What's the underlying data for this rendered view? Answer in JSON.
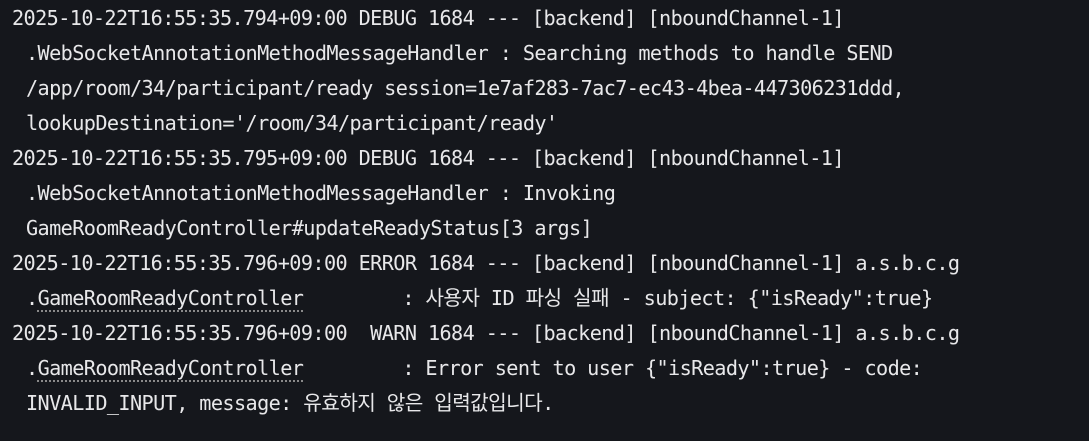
{
  "log": {
    "entries": [
      {
        "header": "2025-10-22T16:55:35.794+09:00 DEBUG 1684 --- [backend] [nboundChannel-1]",
        "logger": ".WebSocketAnnotationMethodMessageHandler",
        "message": " : Searching methods to handle SEND",
        "continuation": [
          "/app/room/34/participant/ready session=1e7af283-7ac7-ec43-4bea-447306231ddd,",
          "lookupDestination='/room/34/participant/ready'"
        ]
      },
      {
        "header": "2025-10-22T16:55:35.795+09:00 DEBUG 1684 --- [backend] [nboundChannel-1]",
        "logger": ".WebSocketAnnotationMethodMessageHandler",
        "message": " : Invoking",
        "continuation": [
          "GameRoomReadyController#updateReadyStatus[3 args]"
        ]
      },
      {
        "header": "2025-10-22T16:55:35.796+09:00 ERROR 1684 --- [backend] [nboundChannel-1] a.s.b.c.g",
        "logger_prefix": ".",
        "logger": "GameRoomReadyController",
        "message": ": 사용자 ID 파싱 실패 - subject: {\"isReady\":true}"
      },
      {
        "header": "2025-10-22T16:55:35.796+09:00  WARN 1684 --- [backend] [nboundChannel-1] a.s.b.c.g",
        "logger_prefix": ".",
        "logger": "GameRoomReadyController",
        "message": ": Error sent to user {\"isReady\":true} - code:",
        "continuation": [
          "INVALID_INPUT, message: 유효하지 않은 입력값입니다."
        ]
      }
    ]
  }
}
